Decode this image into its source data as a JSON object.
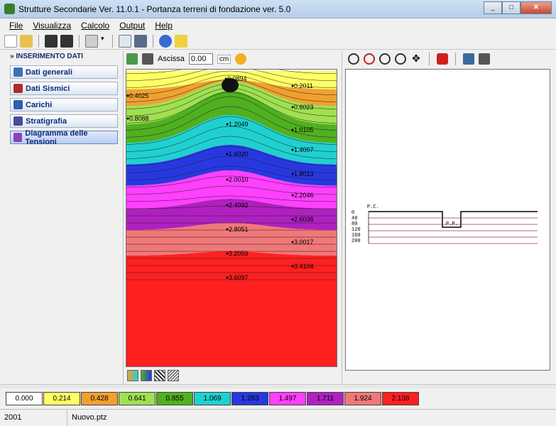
{
  "window": {
    "title": "Strutture Secondarie Ver. 11.0.1 - Portanza terreni di fondazione ver. 5.0",
    "min": "_",
    "max": "□",
    "close": "✕"
  },
  "menu": [
    "File",
    "Visualizza",
    "Calcolo",
    "Output",
    "Help"
  ],
  "toolbar_icons": [
    "new-icon",
    "open-icon",
    "save-icon",
    "save-all-icon",
    "print-setup-icon",
    "dropdown-icon",
    "export-icon",
    "person-icon",
    "info-icon",
    "help-icon"
  ],
  "sidebar": {
    "header": "INSERIMENTO DATI",
    "items": [
      {
        "label": "Dati generali",
        "icon": "data-icon",
        "color": "#3f6fb5"
      },
      {
        "label": "Dati Sismici",
        "icon": "seismic-icon",
        "color": "#b02a2a"
      },
      {
        "label": "Carichi",
        "icon": "loads-icon",
        "color": "#2f5fb0"
      },
      {
        "label": "Stratigrafia",
        "icon": "layers-icon",
        "color": "#4a4a9a"
      },
      {
        "label": "Diagramma delle Tensioni",
        "icon": "diagram-icon",
        "color": "#8a44b8"
      }
    ]
  },
  "stress_panel": {
    "ascissa_label": "Ascissa",
    "ascissa_value": "0.00",
    "unit": "cm"
  },
  "contour_labels": [
    {
      "t": "0.0894"
    },
    {
      "t": "0.2011"
    },
    {
      "t": "0.4025"
    },
    {
      "t": "0.6023"
    },
    {
      "t": "0.8088"
    },
    {
      "t": "1.0105"
    },
    {
      "t": "1.2049"
    },
    {
      "t": "1.4007"
    },
    {
      "t": "1.6020"
    },
    {
      "t": "1.8013"
    },
    {
      "t": "2.0010"
    },
    {
      "t": "2.2046"
    },
    {
      "t": "2.4092"
    },
    {
      "t": "2.6038"
    },
    {
      "t": "2.8051"
    },
    {
      "t": "3.0017"
    },
    {
      "t": "3.2059"
    },
    {
      "t": "3.4104"
    },
    {
      "t": "3.6097"
    }
  ],
  "section": {
    "pc_label": "P.C.",
    "pp_label": "P.P.",
    "depths": [
      "0",
      "40",
      "80",
      "120",
      "160",
      "200"
    ]
  },
  "legend": [
    {
      "value": "0.000",
      "color": "#ffffff"
    },
    {
      "value": "0.214",
      "color": "#ffff66"
    },
    {
      "value": "0.428",
      "color": "#f0a030"
    },
    {
      "value": "0.641",
      "color": "#a0e050"
    },
    {
      "value": "0.855",
      "color": "#50b020"
    },
    {
      "value": "1.069",
      "color": "#20d0d0"
    },
    {
      "value": "1.283",
      "color": "#2838e0"
    },
    {
      "value": "1.497",
      "color": "#ff40ff"
    },
    {
      "value": "1.711",
      "color": "#b020c0"
    },
    {
      "value": "1.924",
      "color": "#f07878"
    },
    {
      "value": "2.138",
      "color": "#ff2020"
    }
  ],
  "status": {
    "left": "2001",
    "file": "Nuovo.ptz"
  }
}
